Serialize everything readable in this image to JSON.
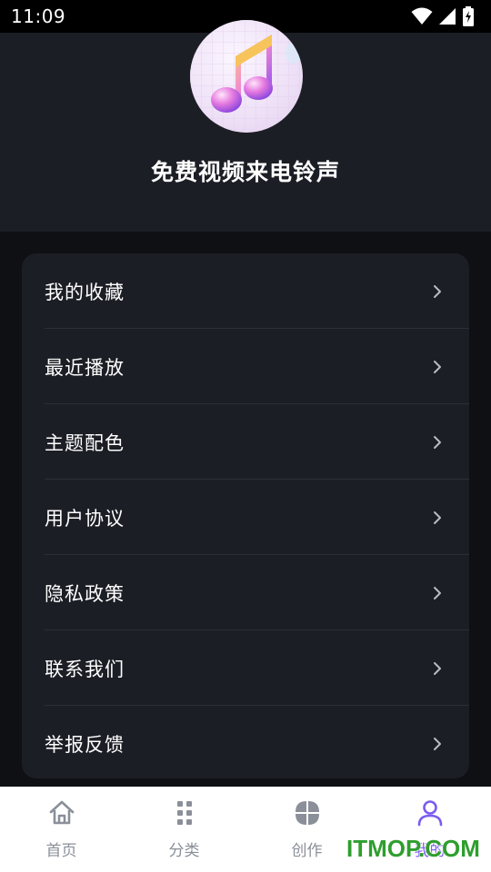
{
  "status_bar": {
    "time": "11:09"
  },
  "app": {
    "title": "免费视频来电铃声"
  },
  "menu": {
    "items": [
      {
        "label": "我的收藏"
      },
      {
        "label": "最近播放"
      },
      {
        "label": "主题配色"
      },
      {
        "label": "用户协议"
      },
      {
        "label": "隐私政策"
      },
      {
        "label": "联系我们"
      },
      {
        "label": "举报反馈"
      }
    ]
  },
  "tabs": [
    {
      "label": "首页",
      "icon": "home-icon"
    },
    {
      "label": "分类",
      "icon": "grid-dots-icon"
    },
    {
      "label": "创作",
      "icon": "four-petals-icon"
    },
    {
      "label": "我的",
      "icon": "person-icon",
      "active": true
    }
  ],
  "watermark": "ITMOP.COM",
  "colors": {
    "background": "#0f1014",
    "card": "#1c1e25",
    "divider": "#2c2f38",
    "accent": "#7b5cf0",
    "tab_inactive": "#8a8f99",
    "watermark": "#2e9e2e"
  }
}
